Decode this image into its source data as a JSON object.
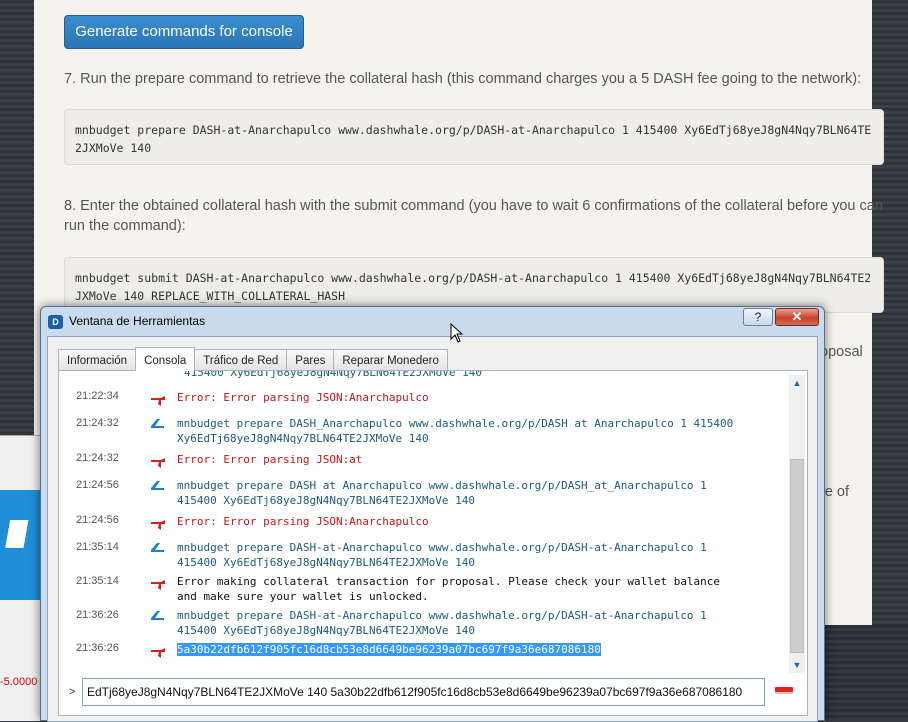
{
  "webpage": {
    "generate_button": "Generate commands for console",
    "step7_text": "7. Run the prepare command to retrieve the collateral hash (this command charges you a 5 DASH fee going to the network):",
    "step7_code": "mnbudget prepare DASH-at-Anarchapulco www.dashwhale.org/p/DASH-at-Anarchapulco 1 415400 Xy6EdTj68yeJ8gN4Nqy7BLN64TE2JXMoVe 140",
    "step8_text": "8. Enter the obtained collateral hash with the submit command (you have to wait 6 confirmations of the collateral before you can run the command):",
    "step8_code": "mnbudget submit DASH-at-Anarchapulco www.dashwhale.org/p/DASH-at-Anarchapulco 1 415400 Xy6EdTj68yeJ8gN4Nqy7BLN64TE2JXMoVe 140 REPLACE_WITH_COLLATERAL_HASH",
    "fragment_1": "oposal",
    "fragment_2": "re of"
  },
  "behind_window": {
    "amount_text": "-5.0000"
  },
  "dialog": {
    "title": "Ventana de Herramientas",
    "help_label": "?",
    "close_label": "✕",
    "tabs": [
      {
        "label": "Información",
        "active": false
      },
      {
        "label": "Consola",
        "active": true
      },
      {
        "label": "Tráfico de Red",
        "active": false
      },
      {
        "label": "Pares",
        "active": false
      },
      {
        "label": "Reparar Monedero",
        "active": false
      }
    ],
    "log_partial_top": "415400 Xy6EdTj68yeJ8gN4Nqy7BLN64TE2JXMoVe 140",
    "log": [
      {
        "time": "21:22:34",
        "kind": "err",
        "text": "Error: Error parsing JSON:Anarchapulco"
      },
      {
        "time": "21:24:32",
        "kind": "cmd",
        "text": "mnbudget prepare DASH_Anarchapulco www.dashwhale.org/p/DASH at Anarchapulco 1 415400\nXy6EdTj68yeJ8gN4Nqy7BLN64TE2JXMoVe 140"
      },
      {
        "time": "21:24:32",
        "kind": "err",
        "text": "Error: Error parsing JSON:at"
      },
      {
        "time": "21:24:56",
        "kind": "cmd",
        "text": "mnbudget prepare DASH at Anarchapulco www.dashwhale.org/p/DASH_at_Anarchapulco 1\n415400 Xy6EdTj68yeJ8gN4Nqy7BLN64TE2JXMoVe 140"
      },
      {
        "time": "21:24:56",
        "kind": "err",
        "text": "Error: Error parsing JSON:Anarchapulco"
      },
      {
        "time": "21:35:14",
        "kind": "cmd",
        "text": "mnbudget prepare DASH-at-Anarchapulco www.dashwhale.org/p/DASH-at-Anarchapulco 1\n415400 Xy6EdTj68yeJ8gN4Nqy7BLN64TE2JXMoVe 140"
      },
      {
        "time": "21:35:14",
        "kind": "plain",
        "text": "Error making collateral transaction for proposal. Please check your wallet balance\nand make sure your wallet is unlocked."
      },
      {
        "time": "21:36:26",
        "kind": "cmd",
        "text": "mnbudget prepare DASH-at-Anarchapulco www.dashwhale.org/p/DASH-at-Anarchapulco 1\n415400 Xy6EdTj68yeJ8gN4Nqy7BLN64TE2JXMoVe 140"
      },
      {
        "time": "21:36:26",
        "kind": "err",
        "text": "5a30b22dfb612f905fc16d8cb53e8d6649be96239a07bc697f9a36e687086180",
        "selected": true
      }
    ],
    "prompt": ">",
    "input_value": "EdTj68yeJ8gN4Nqy7BLN64TE2JXMoVe 140 5a30b22dfb612f905fc16d8cb53e8d6649be96239a07bc697f9a36e687086180",
    "colors": {
      "error": "#c01818",
      "command": "#1a5c7a",
      "selection": "#3399ff",
      "button": "#2a75b5"
    }
  }
}
